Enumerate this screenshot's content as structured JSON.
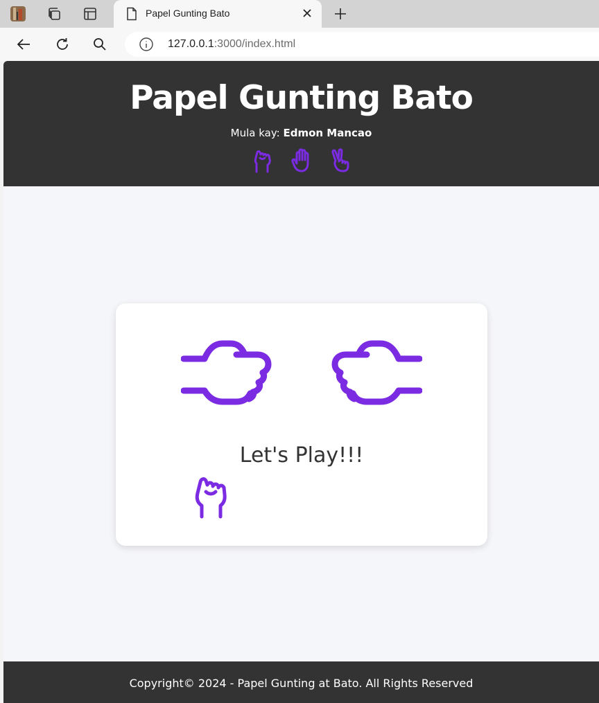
{
  "browser": {
    "tab_title": "Papel Gunting Bato",
    "url_host": "127.0.0.1",
    "url_path": ":3000/index.html"
  },
  "header": {
    "title": "Papel Gunting Bato",
    "byline_prefix": "Mula kay:",
    "author": "Edmon Mancao",
    "choice_icons": [
      "rock-icon",
      "paper-icon",
      "scissors-icon"
    ]
  },
  "game": {
    "status": "Let's Play!!!",
    "player_hand_icon": "rock-hand-icon",
    "computer_hand_icon": "rock-hand-icon",
    "cursor_icon": "hand-pointer-icon"
  },
  "footer": {
    "copyright": "Copyright© 2024 - Papel Gunting at Bato. All Rights Reserved"
  },
  "colors": {
    "accent": "#7b2be2",
    "header_bg": "#333333",
    "page_bg": "#f5f6f9"
  }
}
